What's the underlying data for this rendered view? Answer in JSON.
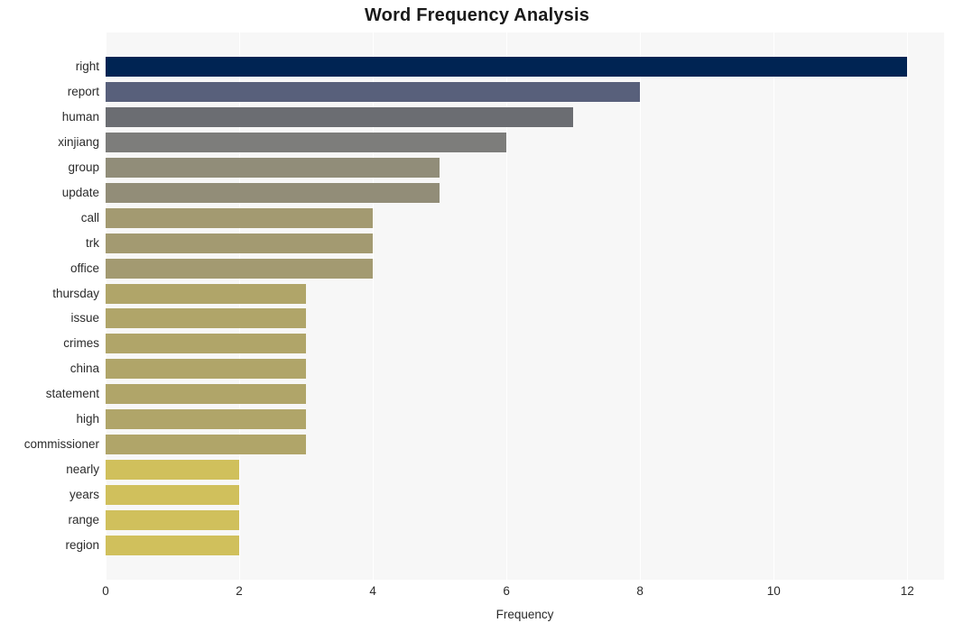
{
  "chart_data": {
    "type": "bar",
    "orientation": "horizontal",
    "title": "Word Frequency Analysis",
    "xlabel": "Frequency",
    "ylabel": "",
    "categories": [
      "right",
      "report",
      "human",
      "xinjiang",
      "group",
      "update",
      "call",
      "trk",
      "office",
      "thursday",
      "issue",
      "crimes",
      "china",
      "statement",
      "high",
      "commissioner",
      "nearly",
      "years",
      "range",
      "region"
    ],
    "values": [
      12,
      8,
      7,
      6,
      5,
      5,
      4,
      4,
      4,
      3,
      3,
      3,
      3,
      3,
      3,
      3,
      2,
      2,
      2,
      2
    ],
    "xlim": [
      0,
      12.55
    ],
    "xticks": [
      0,
      2,
      4,
      6,
      8,
      10,
      12
    ],
    "xtick_labels": [
      "0",
      "2",
      "4",
      "6",
      "8",
      "10",
      "12"
    ],
    "grid": true,
    "grid_axis": "x",
    "grid_color": "#ffffff",
    "legend": false,
    "plot_background": "#f7f7f7",
    "figure_background": "#ffffff",
    "bar_colors": [
      "#002453",
      "#58607b",
      "#6b6d72",
      "#7d7d7b",
      "#918d79",
      "#928d78",
      "#a39a71",
      "#a39a71",
      "#a39a71",
      "#b0a569",
      "#b0a569",
      "#b0a569",
      "#b0a569",
      "#b0a569",
      "#b0a569",
      "#b0a569",
      "#d0c05c",
      "#d0c05c",
      "#d0c05c",
      "#d0c05c"
    ]
  }
}
